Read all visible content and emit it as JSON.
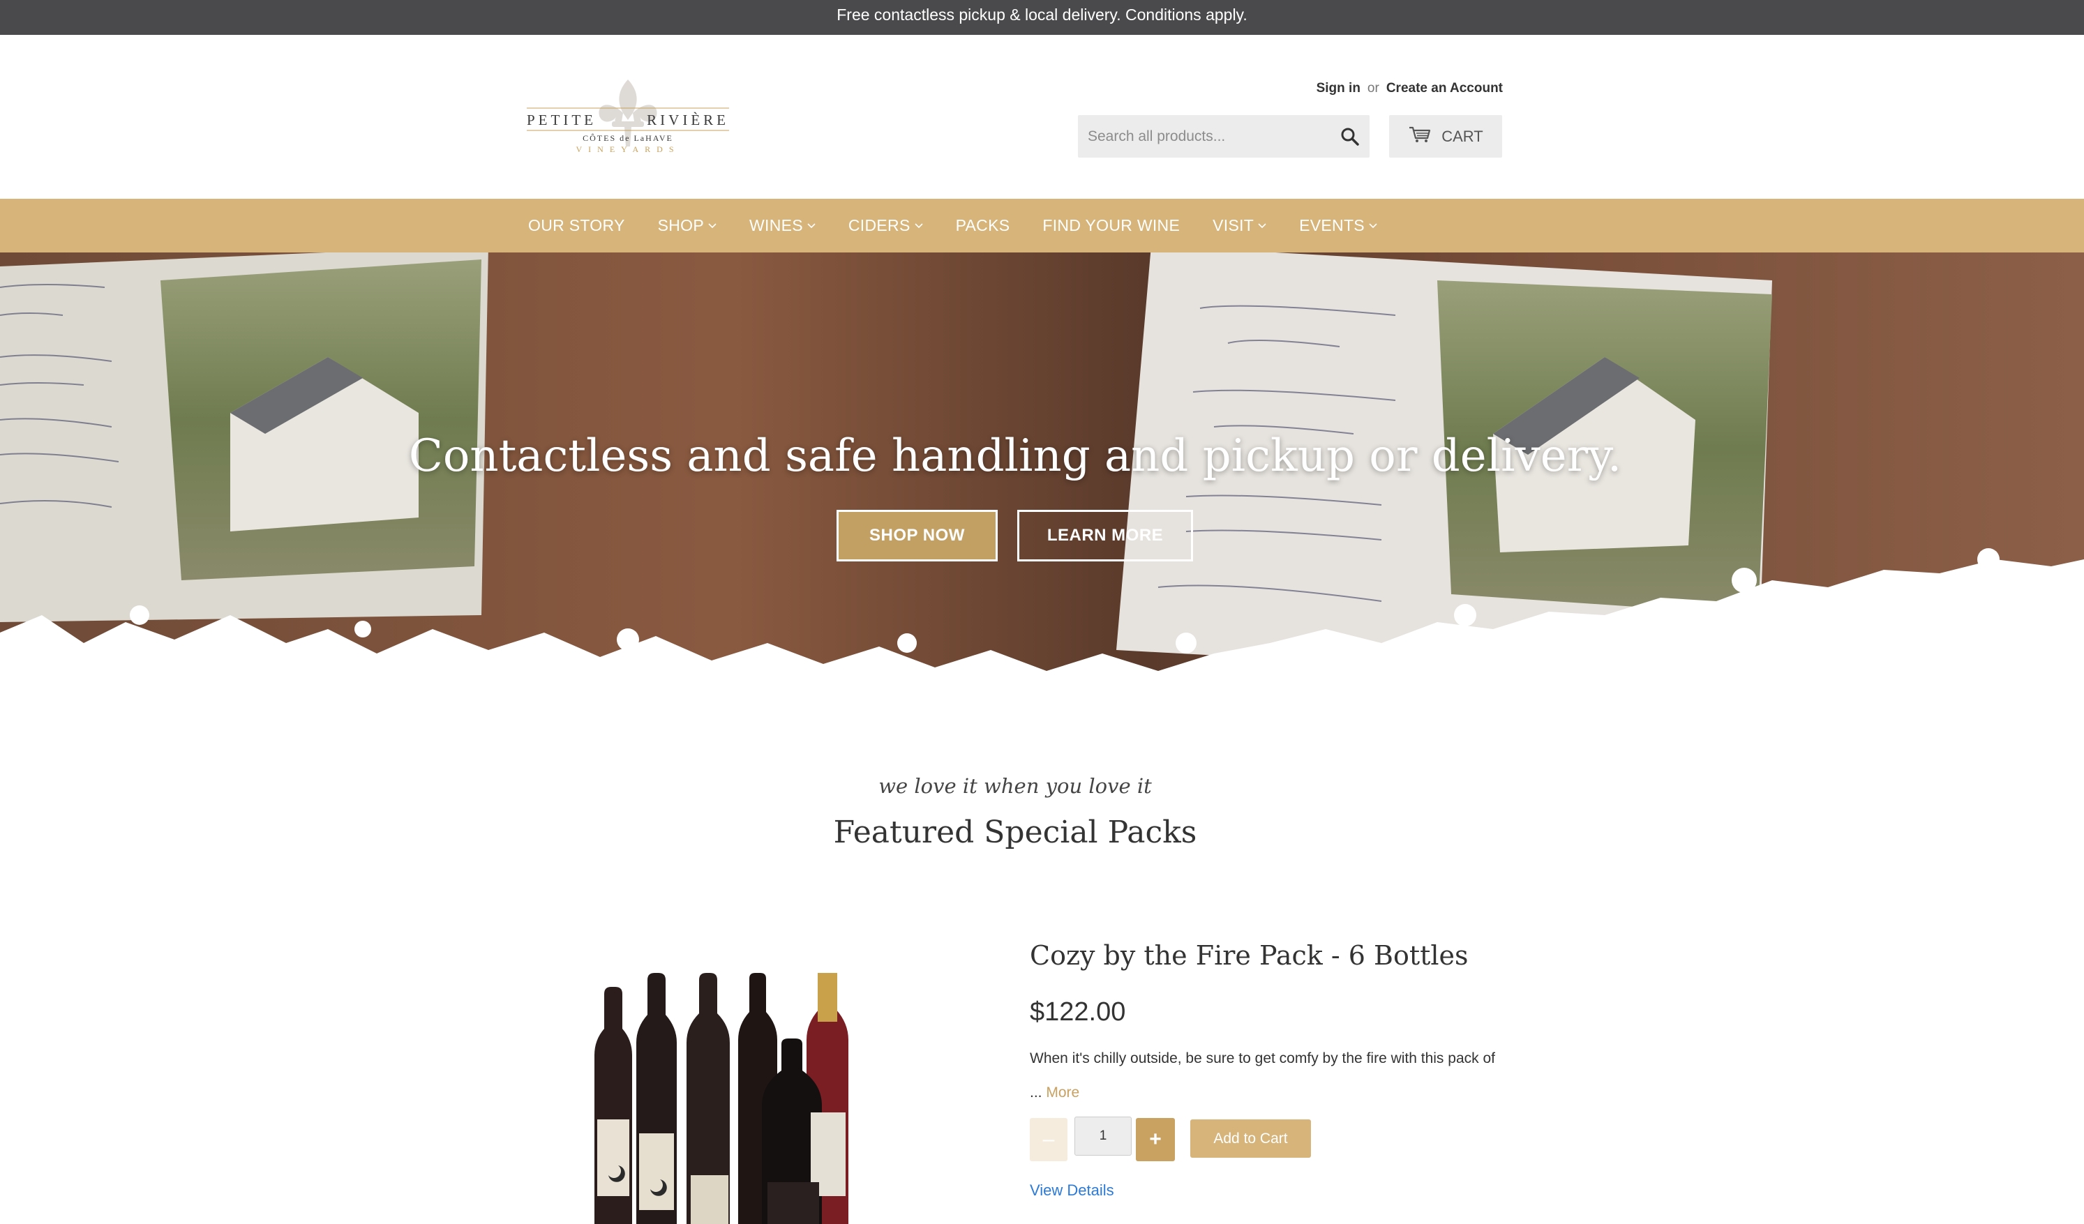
{
  "announcement": "Free contactless pickup & local delivery. Conditions apply.",
  "logo": {
    "line1_left": "PETITE",
    "line1_right": "RIVIÈRE",
    "line2": "CÔTES de LaHAVE",
    "line3": "VINEYARDS"
  },
  "account": {
    "sign_in": "Sign in",
    "or": "or",
    "create": "Create an Account"
  },
  "search": {
    "placeholder": "Search all products..."
  },
  "cart": {
    "label": "CART"
  },
  "nav": {
    "items": [
      {
        "label": "OUR STORY",
        "dropdown": false
      },
      {
        "label": "SHOP",
        "dropdown": true
      },
      {
        "label": "WINES",
        "dropdown": true
      },
      {
        "label": "CIDERS",
        "dropdown": true
      },
      {
        "label": "PACKS",
        "dropdown": false
      },
      {
        "label": "FIND YOUR WINE",
        "dropdown": false
      },
      {
        "label": "VISIT",
        "dropdown": true
      },
      {
        "label": "EVENTS",
        "dropdown": true
      }
    ]
  },
  "hero": {
    "title": "Contactless and safe handling and pickup or delivery.",
    "shop_now": "SHOP NOW",
    "learn_more": "LEARN MORE"
  },
  "featured": {
    "tagline": "we love it when you love it",
    "title": "Featured Special Packs"
  },
  "product": {
    "title": "Cozy by the Fire Pack - 6 Bottles",
    "price": "$122.00",
    "description": "When it's chilly outside, be sure to get comfy by the fire with this pack of",
    "ellipsis": "...",
    "more": "More",
    "qty_minus": "–",
    "qty_value": "1",
    "qty_plus": "+",
    "add_to_cart": "Add to Cart",
    "view_details": "View Details"
  },
  "colors": {
    "accent": "#d6b47a",
    "accent_dark": "#c9a160",
    "announce_bg": "#4a4a4c",
    "link_blue": "#2c7ad6"
  }
}
